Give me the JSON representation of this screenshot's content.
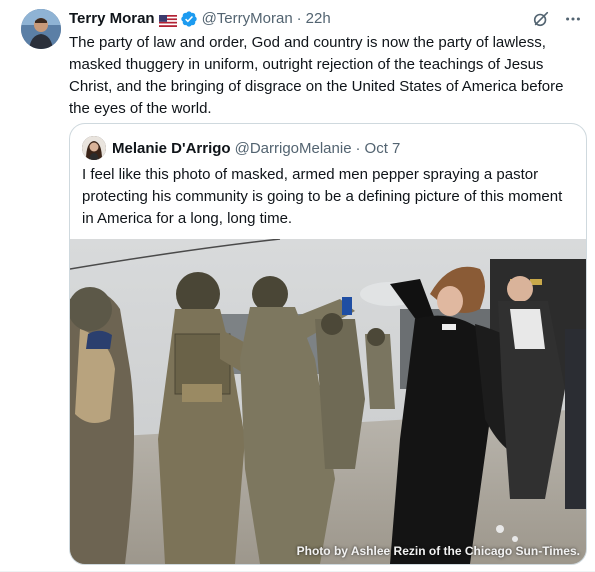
{
  "tweet": {
    "author": {
      "display_name": "Terry Moran",
      "flag_icon": "us-flag-icon",
      "verified_icon": "verified-badge-icon",
      "handle": "@TerryMoran",
      "separator": "·",
      "time": "22h"
    },
    "actions": {
      "grok_icon": "grok-icon",
      "more_icon": "more-icon"
    },
    "text": "The party of law and order, God and country is now the party of lawless, masked thuggery in uniform, outright rejection of the teachings of Jesus Christ, and the bringing of disgrace on the United States of America before the eyes of the world."
  },
  "quote": {
    "author": {
      "display_name": "Melanie D'Arrigo",
      "handle": "@DarrigoMelanie",
      "separator": "·",
      "time": "Oct 7"
    },
    "text": "I feel like this photo of masked, armed men pepper spraying a pastor protecting his community is going to be a defining picture of this moment in America for a long, long time.",
    "photo": {
      "credit": "Photo by Ashlee Rezin of the Chicago Sun-Times."
    }
  },
  "colors": {
    "text_primary": "#0f1419",
    "text_secondary": "#536471",
    "verified_blue": "#1d9bf0",
    "border": "#cfd9de"
  }
}
